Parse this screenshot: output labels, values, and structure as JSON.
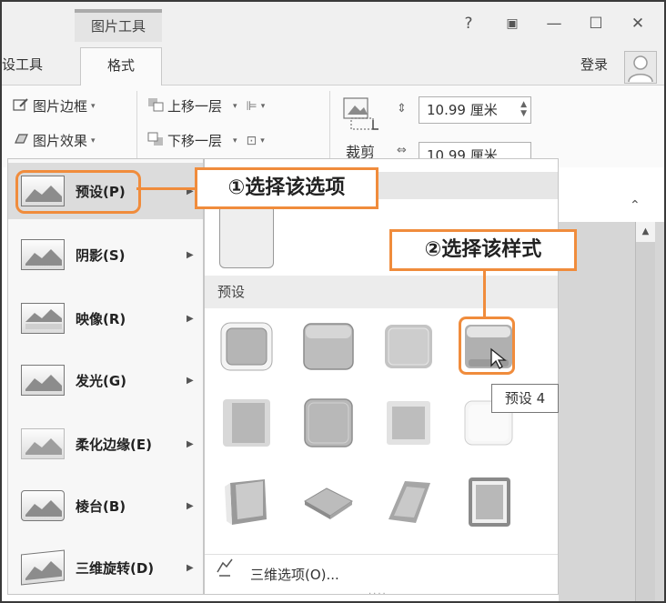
{
  "titlebar": {
    "context_tab": "图片工具",
    "help": "?",
    "ribbon_display": "▣",
    "minimize": "—",
    "maximize": "☐",
    "close": "✕"
  },
  "tabs": {
    "left_partial": "设工具",
    "format": "格式",
    "login": "登录"
  },
  "ribbon": {
    "picture_border": "图片边框",
    "picture_effects": "图片效果",
    "bring_forward": "上移一层",
    "send_backward": "下移一层",
    "crop": "裁剪",
    "height_value": "10.99 厘米",
    "width_value": "10.99 厘米"
  },
  "menu": {
    "items": [
      {
        "label": "预设(P)"
      },
      {
        "label": "阴影(S)"
      },
      {
        "label": "映像(R)"
      },
      {
        "label": "发光(G)"
      },
      {
        "label": "柔化边缘(E)"
      },
      {
        "label": "棱台(B)"
      },
      {
        "label": "三维旋转(D)"
      }
    ]
  },
  "gallery": {
    "section_header": "预设",
    "footer_option": "三维选项(O)...",
    "dots": "....",
    "tooltip": "预设 4"
  },
  "callouts": {
    "step1": "①选择该选项",
    "step2": "②选择该样式"
  },
  "colors": {
    "accent": "#f08c3c",
    "menu_bg": "#f7f7f7",
    "ribbon_bg": "#fafafa"
  }
}
